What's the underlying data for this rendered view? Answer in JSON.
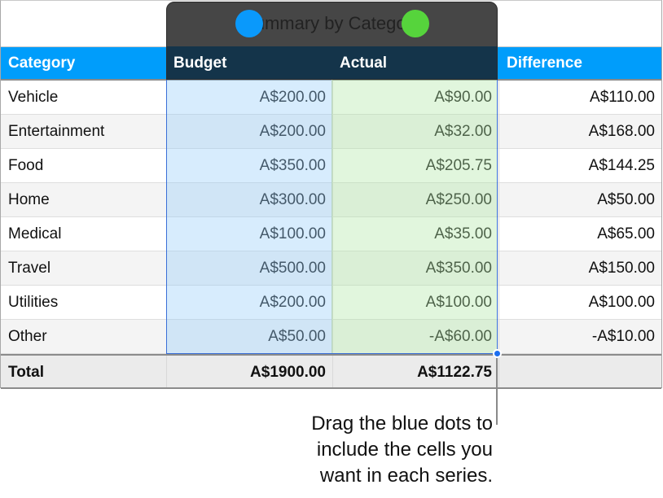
{
  "chart_selection": {
    "title": "Summary by Category",
    "series_dots": [
      {
        "name": "budget-series",
        "color": "#0a99fb"
      },
      {
        "name": "actual-series",
        "color": "#56d43c"
      }
    ]
  },
  "table": {
    "headers": [
      "Category",
      "Budget",
      "Actual",
      "Difference"
    ],
    "rows": [
      {
        "category": "Vehicle",
        "budget": "A$200.00",
        "actual": "A$90.00",
        "difference": "A$110.00"
      },
      {
        "category": "Entertainment",
        "budget": "A$200.00",
        "actual": "A$32.00",
        "difference": "A$168.00"
      },
      {
        "category": "Food",
        "budget": "A$350.00",
        "actual": "A$205.75",
        "difference": "A$144.25"
      },
      {
        "category": "Home",
        "budget": "A$300.00",
        "actual": "A$250.00",
        "difference": "A$50.00"
      },
      {
        "category": "Medical",
        "budget": "A$100.00",
        "actual": "A$35.00",
        "difference": "A$65.00"
      },
      {
        "category": "Travel",
        "budget": "A$500.00",
        "actual": "A$350.00",
        "difference": "A$150.00"
      },
      {
        "category": "Utilities",
        "budget": "A$200.00",
        "actual": "A$100.00",
        "difference": "A$100.00"
      },
      {
        "category": "Other",
        "budget": "A$50.00",
        "actual": "-A$60.00",
        "difference": "-A$10.00"
      }
    ],
    "total": {
      "label": "Total",
      "budget": "A$1900.00",
      "actual": "A$1122.75",
      "difference": ""
    }
  },
  "callout": {
    "lines": [
      "Drag the blue dots to",
      "include the cells you",
      "want in each series."
    ]
  }
}
